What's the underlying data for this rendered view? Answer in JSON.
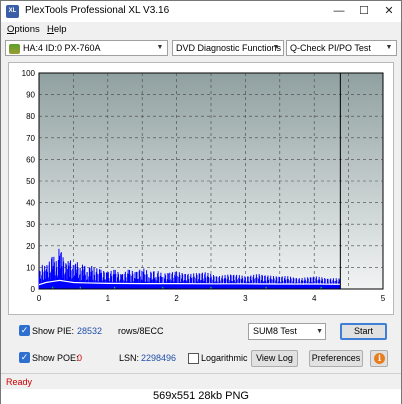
{
  "window": {
    "title": "PlexTools Professional XL V3.16",
    "icon_text": "XL",
    "controls": [
      "—",
      "☐",
      "✕"
    ]
  },
  "menu": {
    "options": {
      "u": "O",
      "rest": "ptions"
    },
    "help": {
      "u": "H",
      "rest": "elp"
    }
  },
  "toolbar": {
    "drive": "HA:4 ID:0  PX-760A",
    "function": "DVD Diagnostic Functions",
    "test": "Q-Check PI/PO Test"
  },
  "chart_data": {
    "type": "area",
    "ylim": [
      0,
      100
    ],
    "xlim": [
      0,
      5
    ],
    "yticks": [
      "100",
      "90",
      "80",
      "70",
      "60",
      "50",
      "40",
      "30",
      "20",
      "10",
      "0"
    ],
    "xticks": [
      "0",
      "1",
      "2",
      "3",
      "4",
      "5"
    ],
    "disc_end_x": 4.38,
    "background_gradient": [
      "#90a0a0",
      "#f2f4f4"
    ],
    "grid": true,
    "series": [
      {
        "color": "#0000ff",
        "style": "bars",
        "x": [
          0.0,
          0.05,
          0.1,
          0.15,
          0.2,
          0.25,
          0.3,
          0.35,
          0.4,
          0.45,
          0.5,
          0.55,
          0.6,
          0.65,
          0.7,
          0.75,
          0.8,
          0.9,
          1.0,
          1.1,
          1.2,
          1.3,
          1.4,
          1.5,
          1.6,
          1.7,
          1.8,
          1.9,
          2.0,
          2.2,
          2.4,
          2.6,
          2.8,
          3.0,
          3.2,
          3.4,
          3.6,
          3.8,
          4.0,
          4.2,
          4.38
        ],
        "values": [
          8,
          12,
          10,
          14,
          16,
          13,
          20,
          15,
          12,
          14,
          11,
          13,
          10,
          12,
          9,
          11,
          10,
          9,
          8,
          9,
          7,
          9,
          8,
          10,
          8,
          9,
          7,
          8,
          8,
          7,
          8,
          6,
          7,
          6,
          7,
          6,
          6,
          5,
          6,
          5,
          5
        ]
      },
      {
        "color": "#ffffff",
        "style": "line",
        "x": [
          0.0,
          0.1,
          0.2,
          0.3,
          0.4,
          0.5,
          0.7,
          1.0,
          1.5,
          2.0,
          2.5,
          3.0,
          3.5,
          4.0,
          4.38
        ],
        "values": [
          2,
          3,
          3.5,
          4,
          3.5,
          3,
          2.8,
          2.6,
          2.5,
          2.5,
          2.4,
          2.4,
          2.3,
          2.3,
          2.2
        ]
      },
      {
        "color": "#00ff00",
        "style": "bars",
        "x": [
          0.2,
          0.6,
          1.1,
          1.8,
          2.5,
          3.3,
          4.1
        ],
        "values": [
          1,
          1,
          1,
          1,
          1,
          1,
          1
        ]
      }
    ]
  },
  "controls": {
    "show_pie": {
      "checked": "✓",
      "label": "Show PIE:",
      "value": "28532",
      "unit": "rows/8ECC"
    },
    "show_poe": {
      "checked": "✓",
      "label": "Show POE:",
      "value": "0"
    },
    "lsn": {
      "label": "LSN:",
      "value": "2298496"
    },
    "logarithmic": "Logarithmic",
    "test_mode": "SUM8 Test",
    "start": "Start",
    "view_log": "View Log",
    "preferences": "Preferences",
    "info": "i"
  },
  "status": "Ready",
  "caption": "569x551  28kb  PNG"
}
